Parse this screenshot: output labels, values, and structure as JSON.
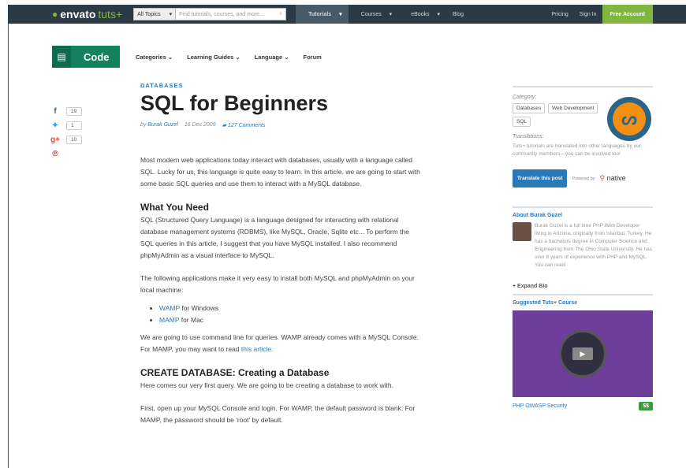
{
  "topnav": {
    "logo_brand": "envato",
    "logo_suffix": "tuts+",
    "topic_select": "All Topics",
    "search_placeholder": "Find tutorials, courses, and more...",
    "links": [
      "Tutorials",
      "Courses",
      "eBooks",
      "Blog"
    ],
    "pricing": "Pricing",
    "signin": "Sign In",
    "free_account": "Free Account"
  },
  "header": {
    "code_label": "Code",
    "subnav": [
      "Categories",
      "Learning Guides",
      "Language",
      "Forum"
    ]
  },
  "social": {
    "facebook_count": "19",
    "twitter_count": "1",
    "googleplus_count": "10"
  },
  "article": {
    "category": "DATABASES",
    "title": "SQL for Beginners",
    "byline_prefix": "by",
    "author": "Burak Guzel",
    "date": "16 Dec 2009",
    "comments": "127 Comments",
    "p1": "Most modern web applications today interact with databases, usually with a language called SQL. Lucky for us, this language is quite easy to learn. In this article, we are going to start with some basic SQL queries and use them to interact with a MySQL database.",
    "h1": "What You Need",
    "p2": "SQL (Structured Query Language) is a language designed for interacting with relational database management systems (RDBMS), like MySQL, Oracle, Sqlite etc... To perform the SQL queries in this article, I suggest that you have MySQL installed. I also recommend phpMyAdmin as a visual interface to MySQL.",
    "p3": "The following applications make it very easy to install both MySQL and phpMyAdmin on your local machine:",
    "list": [
      {
        "link": "WAMP",
        "rest": " for Windows"
      },
      {
        "link": "MAMP",
        "rest": " for Mac"
      }
    ],
    "p4_text": "We are going to use command line for queries. WAMP already comes with a MySQL Console. For MAMP, you may want to read ",
    "p4_link": "this article",
    "p4_end": ".",
    "h2": "CREATE DATABASE: Creating a Database",
    "p5": "Here comes our very first query. We are going to be creating a database to work with.",
    "p6": "First, open up your MySQL Console and login. For WAMP, the default password is blank. For MAMP, the password should be 'root' by default."
  },
  "sidebar": {
    "categories_label": "Category:",
    "tags": [
      "Databases",
      "Web Development",
      "SQL"
    ],
    "translations_label": "Translations:",
    "translations_text": "Tuts+ tutorials are translated into other languages by our community members—you can be involved too!",
    "translate_button": "Translate this post",
    "powered_by": "Powered by",
    "native_label": "native",
    "about_heading": "About Burak Guzel",
    "about_text": "Burak Guzel is a full time PHP Web Developer living in Arizona, originally from Istanbul, Turkey. He has a bachelors degree in Computer Science and Engineering from The Ohio State University. He has over 8 years of experience with PHP and MySQL. You can read",
    "expand_bio": "+ Expand Bio",
    "course_heading": "Suggested Tuts+ Course",
    "course_name": "PHP OWASP Security",
    "course_price": "$$"
  }
}
